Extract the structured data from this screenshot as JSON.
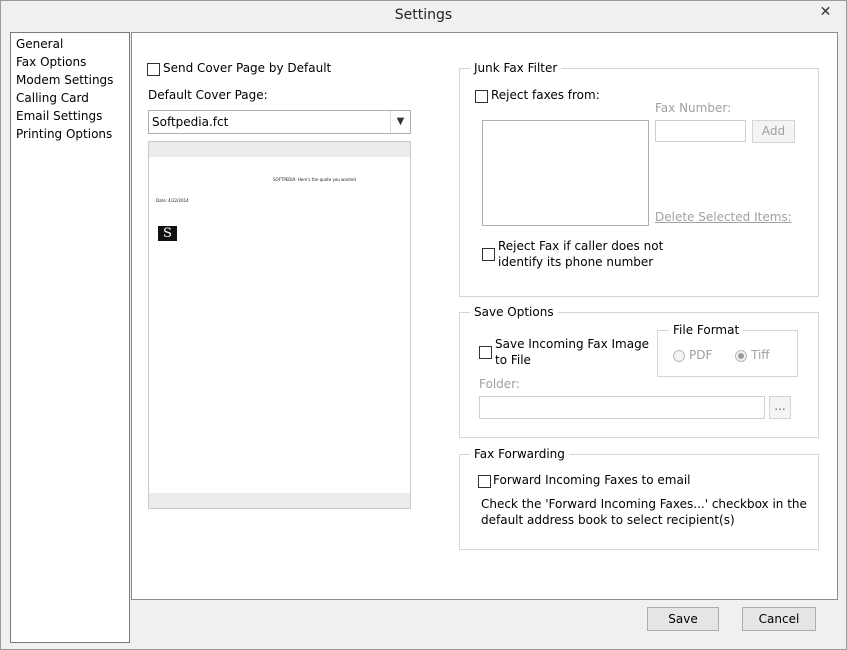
{
  "window": {
    "title": "Settings",
    "close_glyph": "✕"
  },
  "sidebar": {
    "items": [
      {
        "label": "General"
      },
      {
        "label": "Fax Options"
      },
      {
        "label": "Modem Settings"
      },
      {
        "label": "Calling Card"
      },
      {
        "label": "Email Settings"
      },
      {
        "label": "Printing Options"
      }
    ]
  },
  "cover": {
    "send_default_label": "Send Cover Page by Default",
    "default_label": "Default Cover Page:",
    "dropdown_value": "Softpedia.fct",
    "preview": {
      "header_text": "SOFTPEDIA: Here's the quote you wanted",
      "date_text": "Date: 4/22/2014",
      "logo_glyph": "S"
    }
  },
  "junk": {
    "legend": "Junk Fax Filter",
    "reject_from_label": "Reject faxes from:",
    "fax_number_label": "Fax Number:",
    "add_button": "Add",
    "delete_link": "Delete Selected Items:",
    "reject_unidentified_line1": "Reject Fax if caller does not",
    "reject_unidentified_line2": "identify its phone number"
  },
  "save": {
    "legend": "Save Options",
    "save_image_line1": "Save Incoming Fax Image",
    "save_image_line2": "to File",
    "file_format_legend": "File Format",
    "pdf_label": "PDF",
    "tiff_label": "Tiff",
    "folder_label": "Folder:",
    "browse_button": "..."
  },
  "forwarding": {
    "legend": "Fax Forwarding",
    "forward_label": "Forward Incoming Faxes to email",
    "help_line1": "Check the 'Forward Incoming Faxes...' checkbox in the",
    "help_line2": "default address book to select recipient(s)"
  },
  "footer": {
    "save_button": "Save",
    "cancel_button": "Cancel"
  },
  "colors": {
    "window_bg": "#f0f0f0",
    "panel_bg": "#ffffff",
    "disabled_text": "#a0a0a0",
    "border": "#8d8d8d"
  }
}
